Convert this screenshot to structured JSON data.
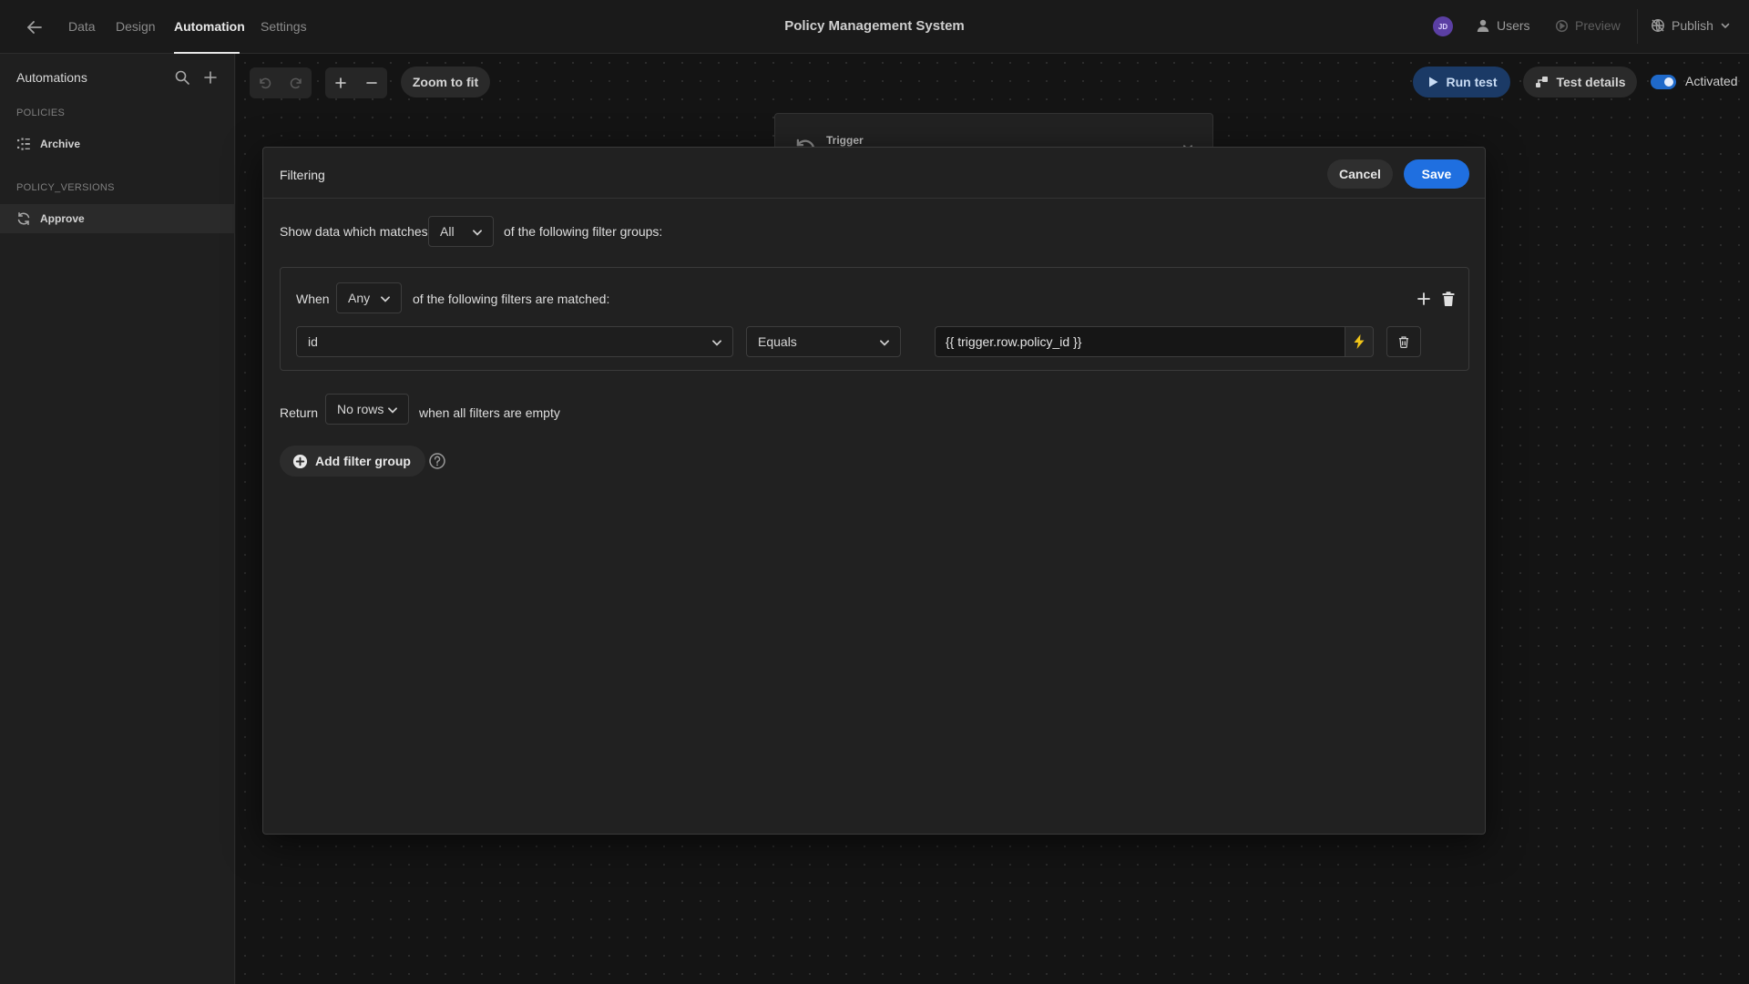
{
  "app": {
    "title": "Policy Management System"
  },
  "nav": {
    "back_icon": "arrow-left-icon",
    "tabs": [
      {
        "label": "Data"
      },
      {
        "label": "Design"
      },
      {
        "label": "Automation",
        "active": true
      },
      {
        "label": "Settings"
      }
    ]
  },
  "topbar": {
    "avatar_initials": "JD",
    "users_label": "Users",
    "preview_label": "Preview",
    "publish_label": "Publish"
  },
  "sidebar": {
    "title": "Automations",
    "sections": [
      {
        "heading": "POLICIES",
        "items": [
          {
            "label": "Archive",
            "icon": "branch-icon"
          }
        ]
      },
      {
        "heading": "POLICY_VERSIONS",
        "items": [
          {
            "label": "Approve",
            "icon": "refresh-icon",
            "selected": true
          }
        ]
      }
    ]
  },
  "canvas_toolbar": {
    "zoom_to_fit": "Zoom to fit",
    "run_test": "Run test",
    "test_details": "Test details",
    "activated_label": "Activated",
    "activated": true
  },
  "trigger_card": {
    "label": "Trigger"
  },
  "modal": {
    "title": "Filtering",
    "cancel_label": "Cancel",
    "save_label": "Save",
    "show_prefix": "Show data which matches",
    "match_value": "All",
    "show_suffix": "of the following filter groups:",
    "group": {
      "when_label": "When",
      "match_value": "Any",
      "suffix": "of the following filters are matched:",
      "filter": {
        "field": "id",
        "operator": "Equals",
        "value": "{{ trigger.row.policy_id }}"
      }
    },
    "return_label": "Return",
    "return_value": "No rows",
    "return_suffix": "when all filters are empty",
    "add_group_label": "Add filter group"
  },
  "colors": {
    "accent": "#1f6fe0",
    "bolt": "#f0c419",
    "avatar": "#5b3fa3"
  }
}
